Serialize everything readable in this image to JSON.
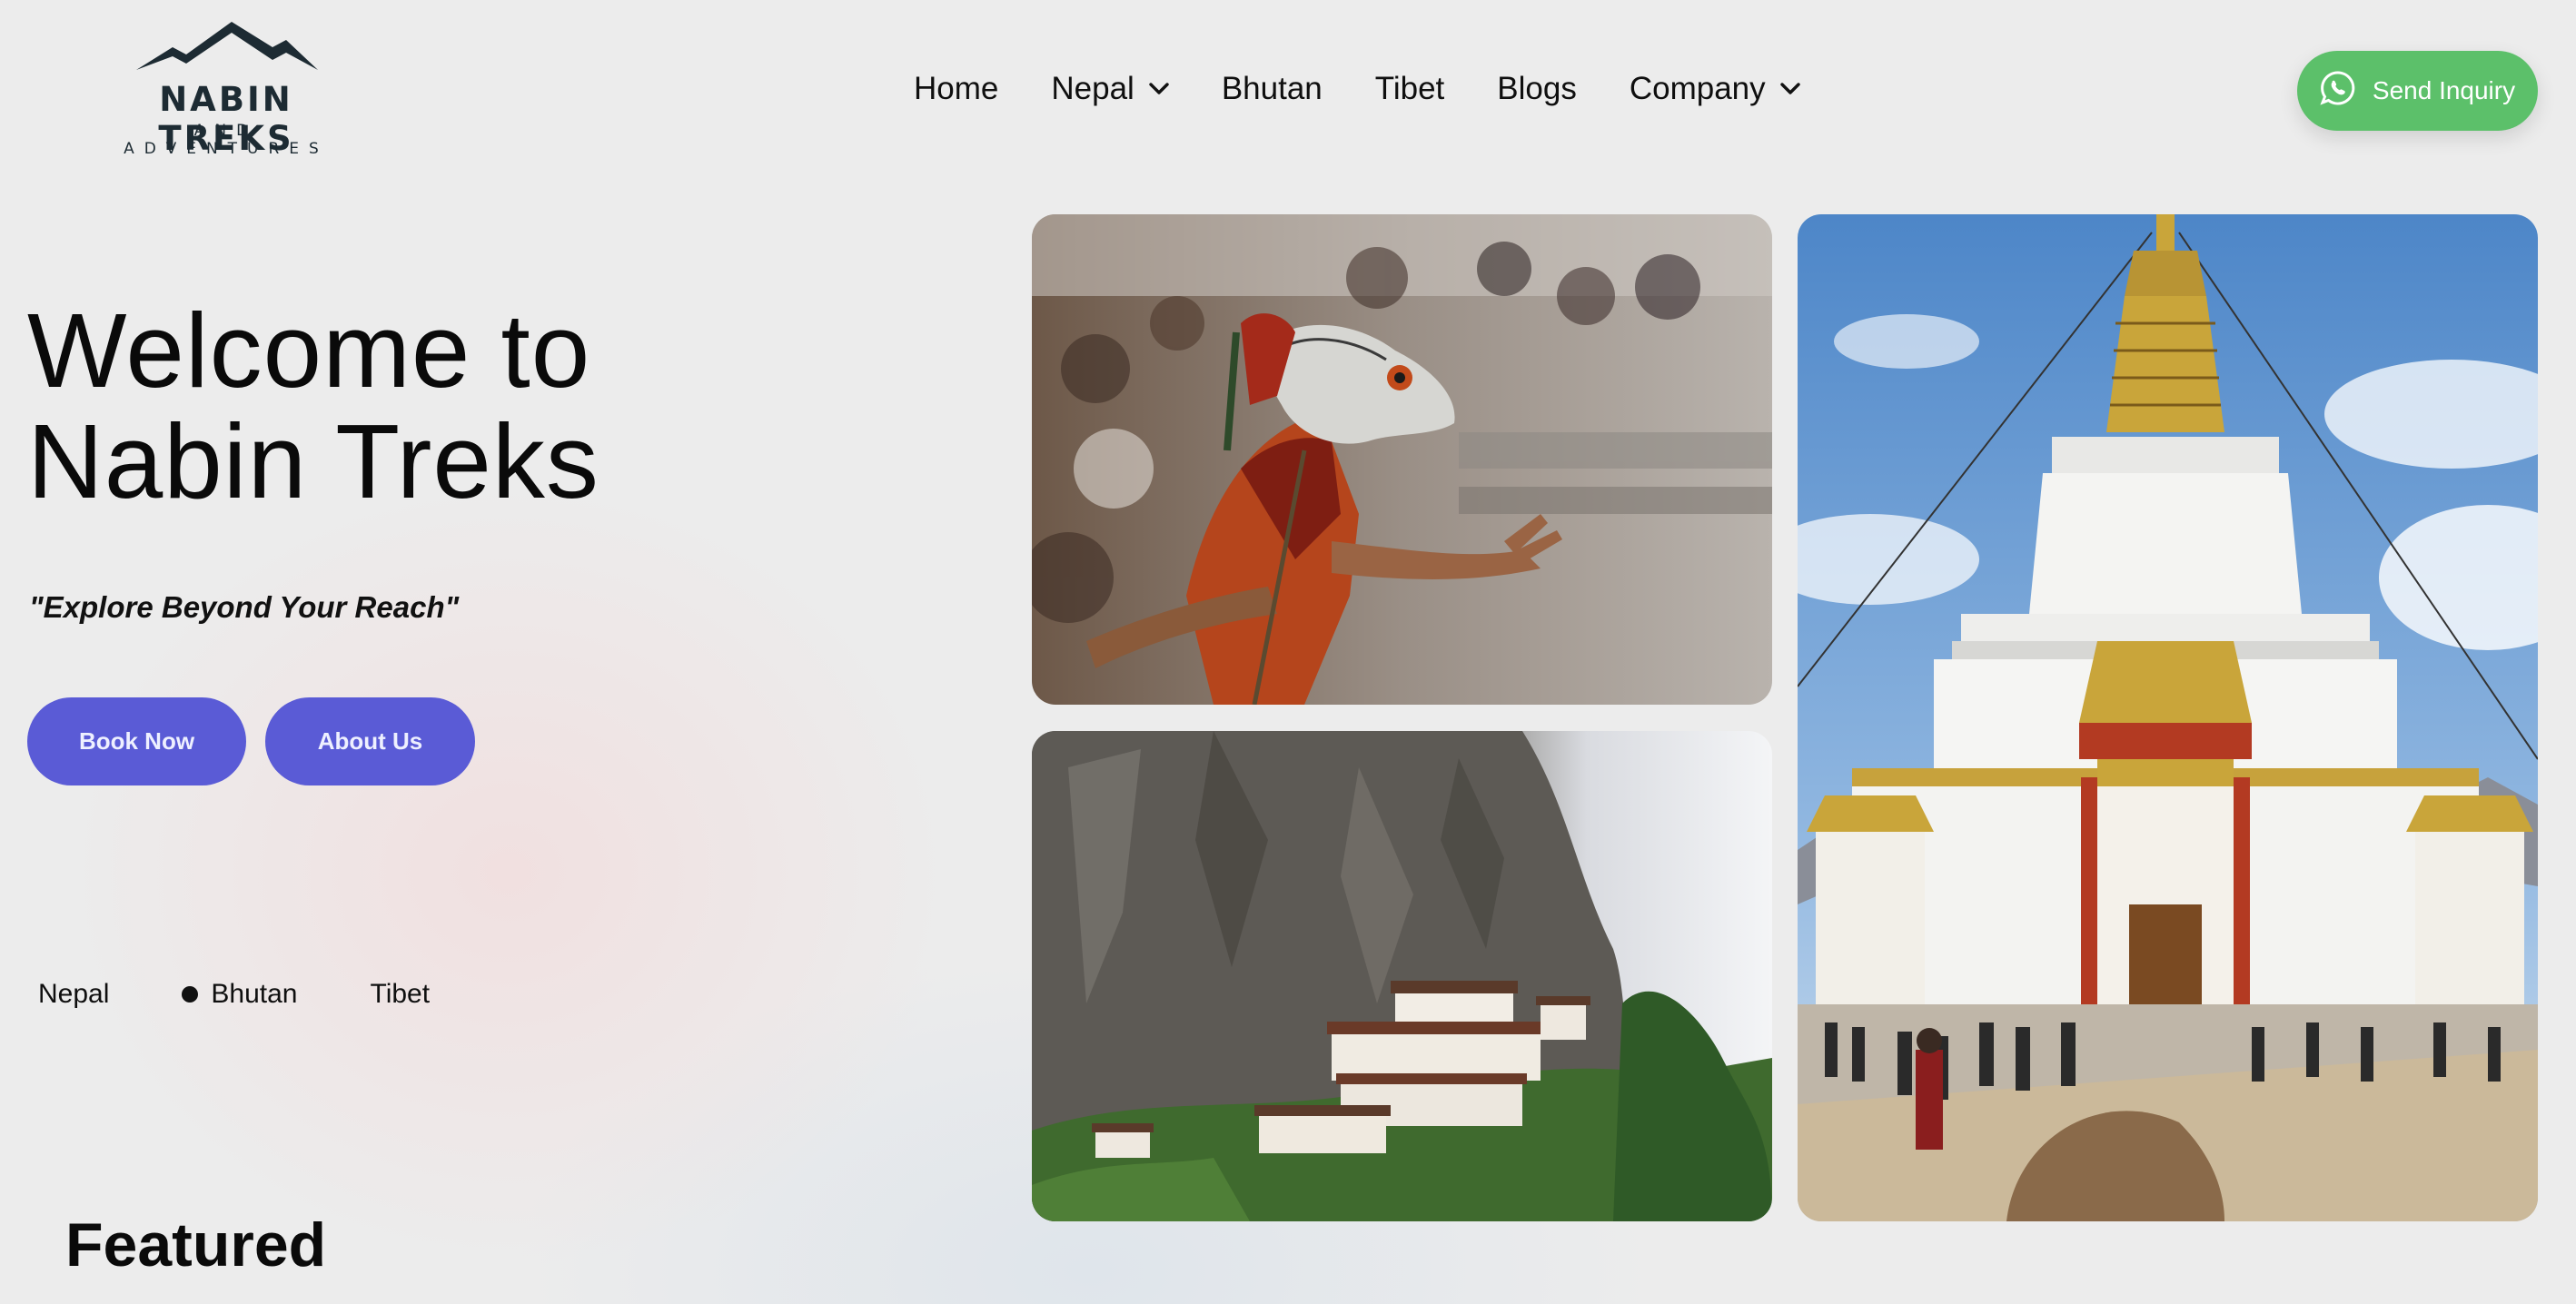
{
  "brand": {
    "name": "NABIN TREKS",
    "subtitle": "AND ADVENTURES",
    "logo_icon": "mountain-icon"
  },
  "nav": {
    "items": [
      {
        "label": "Home",
        "has_dropdown": false
      },
      {
        "label": "Nepal",
        "has_dropdown": true
      },
      {
        "label": "Bhutan",
        "has_dropdown": false
      },
      {
        "label": "Tibet",
        "has_dropdown": false
      },
      {
        "label": "Blogs",
        "has_dropdown": false
      },
      {
        "label": "Company",
        "has_dropdown": true
      }
    ],
    "inquiry_label": "Send Inquiry",
    "inquiry_icon": "whatsapp-icon",
    "inquiry_color": "#5cc06a"
  },
  "hero": {
    "title_line1": "Welcome to",
    "title_line2": "Nabin Treks",
    "tagline": "\"Explore Beyond Your Reach\"",
    "primary_button": "Book Now",
    "secondary_button": "About Us",
    "button_color": "#5a5bd6"
  },
  "destinations": {
    "tabs": [
      {
        "label": "Nepal",
        "active": false
      },
      {
        "label": "Bhutan",
        "active": true
      },
      {
        "label": "Tibet",
        "active": false
      }
    ]
  },
  "sections": {
    "featured_heading": "Featured"
  },
  "gallery": {
    "images": [
      "masked-dancer-photo",
      "cliffside-monastery-photo",
      "white-stupa-photo"
    ]
  }
}
